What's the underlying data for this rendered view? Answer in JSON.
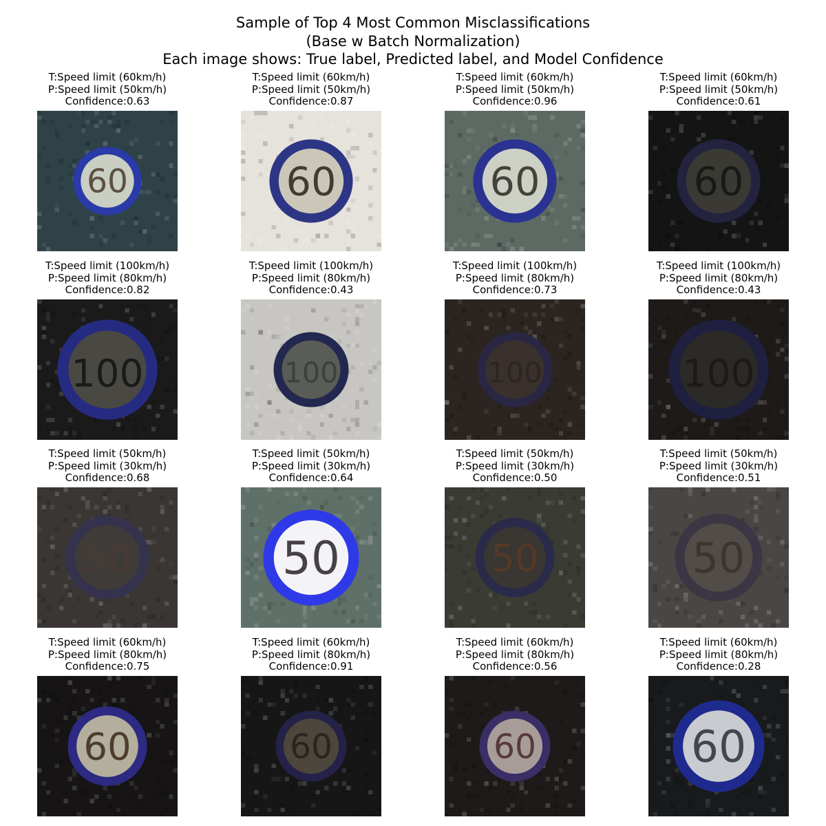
{
  "figure": {
    "title_lines": [
      "Sample of Top 4 Most Common Misclassifications",
      "(Base w Batch Normalization)",
      "Each image shows: True label, Predicted label, and Model Confidence"
    ]
  },
  "panels": [
    {
      "true": "T:Speed limit (60km/h)",
      "pred": "P:Speed limit (50km/h)",
      "conf": "Confidence:0.63",
      "sign_text": "60",
      "bg": "#2e4248",
      "ring": "#2a3aa8",
      "face": "#c9cfc2",
      "digit": "#4a3a2a",
      "scale": 0.82
    },
    {
      "true": "T:Speed limit (60km/h)",
      "pred": "P:Speed limit (50km/h)",
      "conf": "Confidence:0.87",
      "sign_text": "60",
      "bg": "#e6e2dc",
      "ring": "#2d3585",
      "face": "#cbc7b8",
      "digit": "#2a2418",
      "scale": 1.0
    },
    {
      "true": "T:Speed limit (60km/h)",
      "pred": "P:Speed limit (50km/h)",
      "conf": "Confidence:0.96",
      "sign_text": "60",
      "bg": "#5d6a63",
      "ring": "#2a3391",
      "face": "#cdd0c4",
      "digit": "#2b2b24",
      "scale": 1.0
    },
    {
      "true": "T:Speed limit (60km/h)",
      "pred": "P:Speed limit (50km/h)",
      "conf": "Confidence:0.61",
      "sign_text": "60",
      "bg": "#141414",
      "ring": "#23233f",
      "face": "#3a3934",
      "digit": "#141410",
      "scale": 1.0
    },
    {
      "true": "T:Speed limit (100km/h)",
      "pred": "P:Speed limit (80km/h)",
      "conf": "Confidence:0.82",
      "sign_text": "100",
      "bg": "#1a1a1a",
      "ring": "#262b82",
      "face": "#4a4842",
      "digit": "#121212",
      "scale": 1.2
    },
    {
      "true": "T:Speed limit (100km/h)",
      "pred": "P:Speed limit (80km/h)",
      "conf": "Confidence:0.43",
      "sign_text": "100",
      "bg": "#c8c6c2",
      "ring": "#22284f",
      "face": "#5a5c57",
      "digit": "#3a3c38",
      "scale": 0.9
    },
    {
      "true": "T:Speed limit (100km/h)",
      "pred": "P:Speed limit (80km/h)",
      "conf": "Confidence:0.73",
      "sign_text": "100",
      "bg": "#2b2420",
      "ring": "#2a2744",
      "face": "#3a312d",
      "digit": "#2a2420",
      "scale": 0.9
    },
    {
      "true": "T:Speed limit (100km/h)",
      "pred": "P:Speed limit (80km/h)",
      "conf": "Confidence:0.43",
      "sign_text": "100",
      "bg": "#1e1a18",
      "ring": "#1f1f40",
      "face": "#2c2a26",
      "digit": "#1a1816",
      "scale": 1.2
    },
    {
      "true": "T:Speed limit (50km/h)",
      "pred": "P:Speed limit (30km/h)",
      "conf": "Confidence:0.68",
      "sign_text": "50",
      "bg": "#3a3634",
      "ring": "#34324c",
      "face": "#3f3b38",
      "digit": "#4a3a34",
      "scale": 1.0
    },
    {
      "true": "T:Speed limit (50km/h)",
      "pred": "P:Speed limit (30km/h)",
      "conf": "Confidence:0.64",
      "sign_text": "50",
      "bg": "#5f7068",
      "ring": "#2e3ae8",
      "face": "#f4f4f8",
      "digit": "#2a2228",
      "scale": 1.15
    },
    {
      "true": "T:Speed limit (50km/h)",
      "pred": "P:Speed limit (30km/h)",
      "conf": "Confidence:0.50",
      "sign_text": "50",
      "bg": "#3a3c34",
      "ring": "#2a2a4a",
      "face": "#3a3632",
      "digit": "#5a3a24",
      "scale": 0.95
    },
    {
      "true": "T:Speed limit (50km/h)",
      "pred": "P:Speed limit (30km/h)",
      "conf": "Confidence:0.51",
      "sign_text": "50",
      "bg": "#4a4644",
      "ring": "#3a3644",
      "face": "#514c48",
      "digit": "#3a302a",
      "scale": 1.05
    },
    {
      "true": "T:Speed limit (60km/h)",
      "pred": "P:Speed limit (80km/h)",
      "conf": "Confidence:0.75",
      "sign_text": "60",
      "bg": "#161414",
      "ring": "#2c2a82",
      "face": "#b4ae9c",
      "digit": "#3a2a1a",
      "scale": 0.95
    },
    {
      "true": "T:Speed limit (60km/h)",
      "pred": "P:Speed limit (80km/h)",
      "conf": "Confidence:0.91",
      "sign_text": "60",
      "bg": "#161616",
      "ring": "#242248",
      "face": "#4c463c",
      "digit": "#24201a",
      "scale": 0.85
    },
    {
      "true": "T:Speed limit (60km/h)",
      "pred": "P:Speed limit (80km/h)",
      "conf": "Confidence:0.56",
      "sign_text": "60",
      "bg": "#1e1a1a",
      "ring": "#3a2e66",
      "face": "#a89c98",
      "digit": "#4a2a2a",
      "scale": 0.85
    },
    {
      "true": "T:Speed limit (60km/h)",
      "pred": "P:Speed limit (80km/h)",
      "conf": "Confidence:0.28",
      "sign_text": "60",
      "bg": "#181a1c",
      "ring": "#1f2a8e",
      "face": "#c8ccd0",
      "digit": "#2a3038",
      "scale": 1.1
    }
  ]
}
